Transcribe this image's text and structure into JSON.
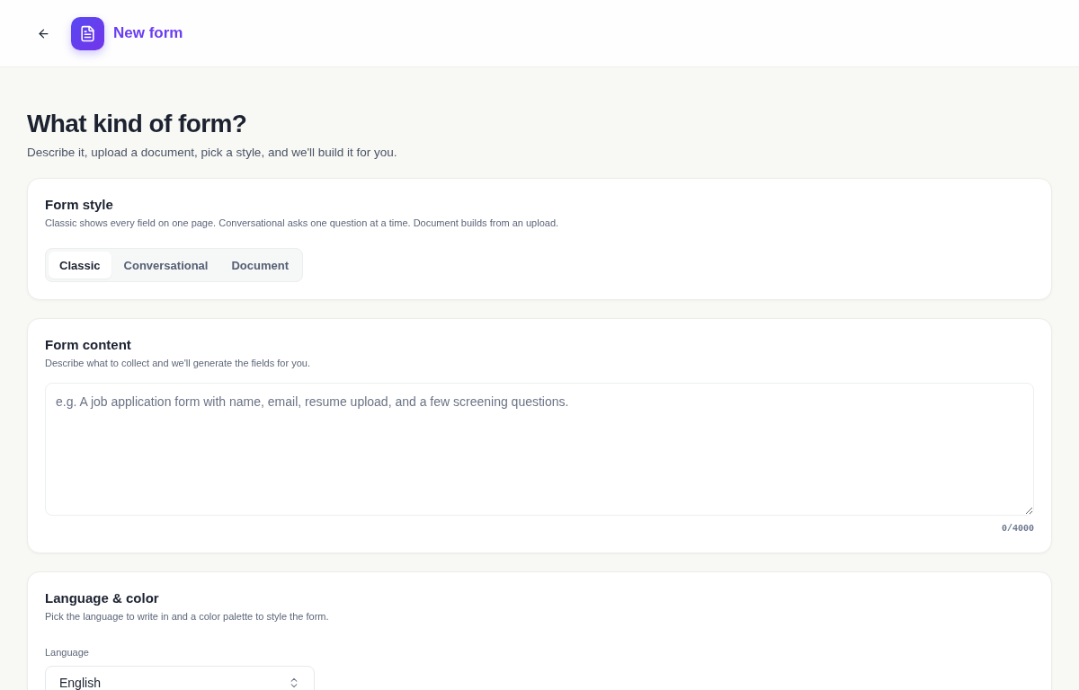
{
  "header": {
    "title": "New form"
  },
  "page": {
    "title": "What kind of form?",
    "subtitle": "Describe it, upload a document, pick a style, and we'll build it for you."
  },
  "sections": [
    {
      "kind": "style",
      "title": "Form style",
      "description": "Classic shows every field on one page. Conversational asks one question at a time. Document builds from an upload.",
      "options": [
        {
          "label": "Classic",
          "selected": true
        },
        {
          "label": "Conversational",
          "selected": false
        },
        {
          "label": "Document",
          "selected": false
        }
      ]
    },
    {
      "kind": "content",
      "title": "Form content",
      "description": "Describe what to collect and we'll generate the fields for you.",
      "textarea": {
        "placeholder": "e.g. A job application form with name, email, resume upload, and a few screening questions.",
        "counter": "0/4000"
      }
    },
    {
      "kind": "language",
      "title": "Language & color",
      "description": "Pick the language to write in and a color palette to style the form.",
      "language": {
        "label": "Language",
        "value": "English"
      }
    }
  ]
}
